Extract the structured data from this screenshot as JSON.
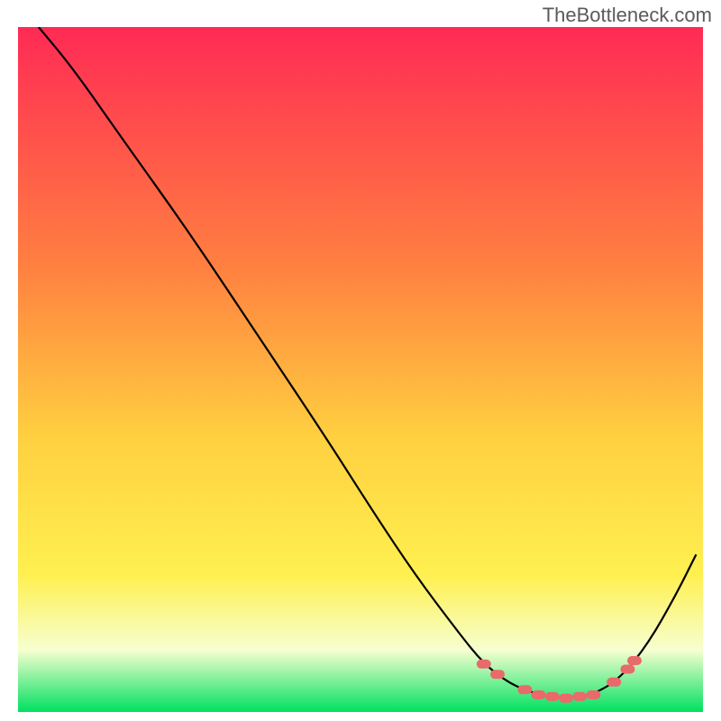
{
  "watermark": "TheBottleneck.com",
  "chart_data": {
    "type": "line",
    "title": "",
    "xlabel": "",
    "ylabel": "",
    "xlim": [
      0,
      100
    ],
    "ylim": [
      0,
      100
    ],
    "gradient": {
      "top": "#ff2a55",
      "mid_upper": "#ff8040",
      "mid": "#ffd040",
      "mid_lower": "#fff050",
      "band": "#f6ffd0",
      "bottom": "#00e060"
    },
    "curve": [
      {
        "x": 3,
        "y": 100
      },
      {
        "x": 8,
        "y": 94
      },
      {
        "x": 15,
        "y": 84
      },
      {
        "x": 25,
        "y": 70
      },
      {
        "x": 35,
        "y": 55
      },
      {
        "x": 45,
        "y": 40
      },
      {
        "x": 52,
        "y": 29
      },
      {
        "x": 58,
        "y": 20
      },
      {
        "x": 64,
        "y": 12
      },
      {
        "x": 68,
        "y": 7
      },
      {
        "x": 72,
        "y": 4
      },
      {
        "x": 76,
        "y": 2.5
      },
      {
        "x": 80,
        "y": 2
      },
      {
        "x": 84,
        "y": 2.5
      },
      {
        "x": 88,
        "y": 5
      },
      {
        "x": 92,
        "y": 10
      },
      {
        "x": 96,
        "y": 17
      },
      {
        "x": 99,
        "y": 23
      }
    ],
    "marker_xs": [
      68,
      70,
      74,
      76,
      78,
      80,
      82,
      84,
      87,
      89,
      90
    ],
    "marker_color": "#e96a6a",
    "curve_color": "#000000"
  }
}
